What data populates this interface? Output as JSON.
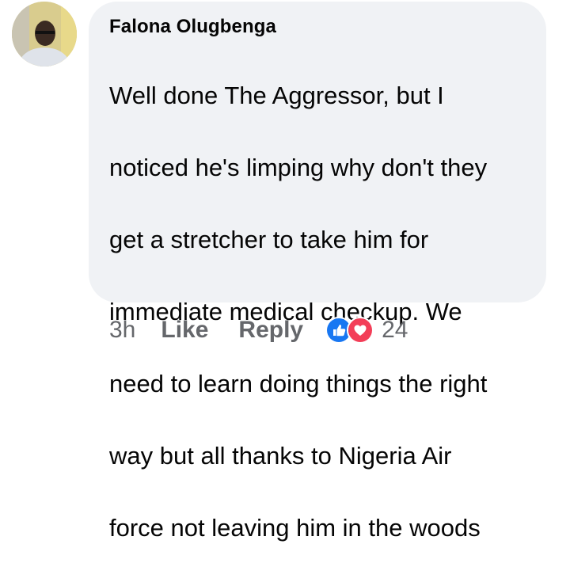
{
  "comment": {
    "author": "Falona Olugbenga",
    "lines": [
      "Well done The Aggressor, but I",
      "noticed he's limping why don't they",
      "get a stretcher to take him for",
      "immediate medical checkup. We",
      "need to learn doing things the right",
      "way but all thanks to Nigeria Air",
      "force not leaving him in the woods"
    ]
  },
  "actions": {
    "timestamp": "3h",
    "like_label": "Like",
    "reply_label": "Reply",
    "reaction_count": "24"
  },
  "reactions": [
    "like-icon",
    "love-icon"
  ],
  "colors": {
    "bubble": "#f0f2f5",
    "text": "#050505",
    "meta": "#65676b",
    "like": "#1877f2",
    "love": "#f33e58"
  }
}
